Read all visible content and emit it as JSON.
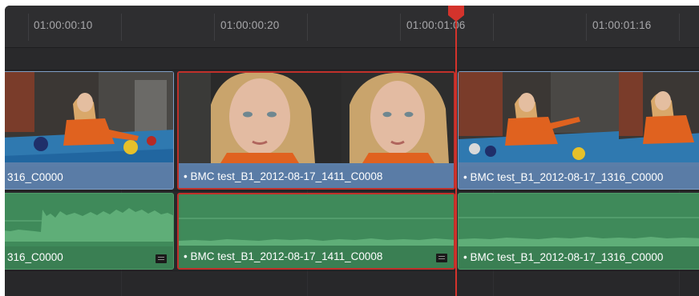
{
  "ruler": {
    "timecodes": [
      "01:00:00:10",
      "01:00:00:20",
      "01:00:01:06",
      "01:00:01:16"
    ]
  },
  "tracks": {
    "video": [
      {
        "label": "316_C0000",
        "selected": false
      },
      {
        "label": "• BMC test_B1_2012-08-17_1411_C0008",
        "selected": true
      },
      {
        "label": "• BMC test_B1_2012-08-17_1316_C0000",
        "selected": false
      }
    ],
    "audio": [
      {
        "label": "316_C0000",
        "selected": false
      },
      {
        "label": "• BMC test_B1_2012-08-17_1411_C0008",
        "selected": true
      },
      {
        "label": "• BMC test_B1_2012-08-17_1316_C0000",
        "selected": false
      }
    ]
  },
  "colors": {
    "playhead": "#d4332c",
    "video_clip": "#5a7ca6",
    "audio_clip": "#3f8a5a",
    "selection": "#c0302a"
  },
  "icons": {
    "playhead": "playhead-marker-icon",
    "audio": "audio-waveform-icon"
  }
}
